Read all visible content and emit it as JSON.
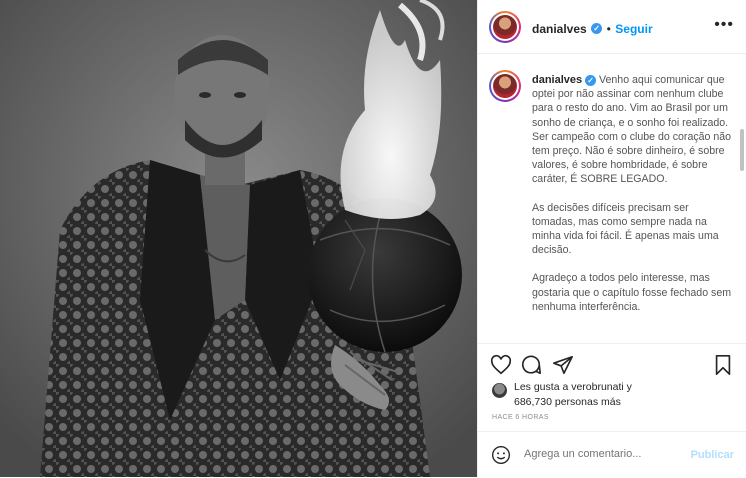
{
  "post": {
    "username": "danialves",
    "verified_glyph": "✓",
    "separator": "•",
    "follow_label": "Seguir",
    "more_icon": "more-horizontal-icon"
  },
  "caption": {
    "username": "danialves",
    "paragraphs": [
      "Venho aqui comunicar que optei por não assinar com nenhum clube para o resto do ano. Vim ao Brasil por um sonho de criança, e o sonho foi realizado. Ser campeão com o clube do coração não tem preço. Não é sobre dinheiro, é sobre valores, é sobre hombridade, é sobre caráter, É SOBRE LEGADO.",
      "As decisões difíceis precisam ser tomadas, mas como sempre nada na minha vida foi fácil. É apenas mais uma decisão.",
      "Agradeço a todos pelo interesse, mas gostaria que o capítulo fosse fechado sem nenhuma interferência."
    ]
  },
  "actions": {
    "like_icon": "heart-icon",
    "comment_icon": "comment-icon",
    "share_icon": "paper-plane-icon",
    "save_icon": "bookmark-icon"
  },
  "likes": {
    "line1": "Les gusta a verobrunati y",
    "line2": "686,730 personas más"
  },
  "timestamp": "HACE 6 HORAS",
  "comment_box": {
    "placeholder": "Agrega un comentario...",
    "publish_label": "Publicar"
  },
  "colors": {
    "accent": "#0095f6",
    "verified": "#3897f0",
    "publish_disabled": "#b2dffc"
  }
}
